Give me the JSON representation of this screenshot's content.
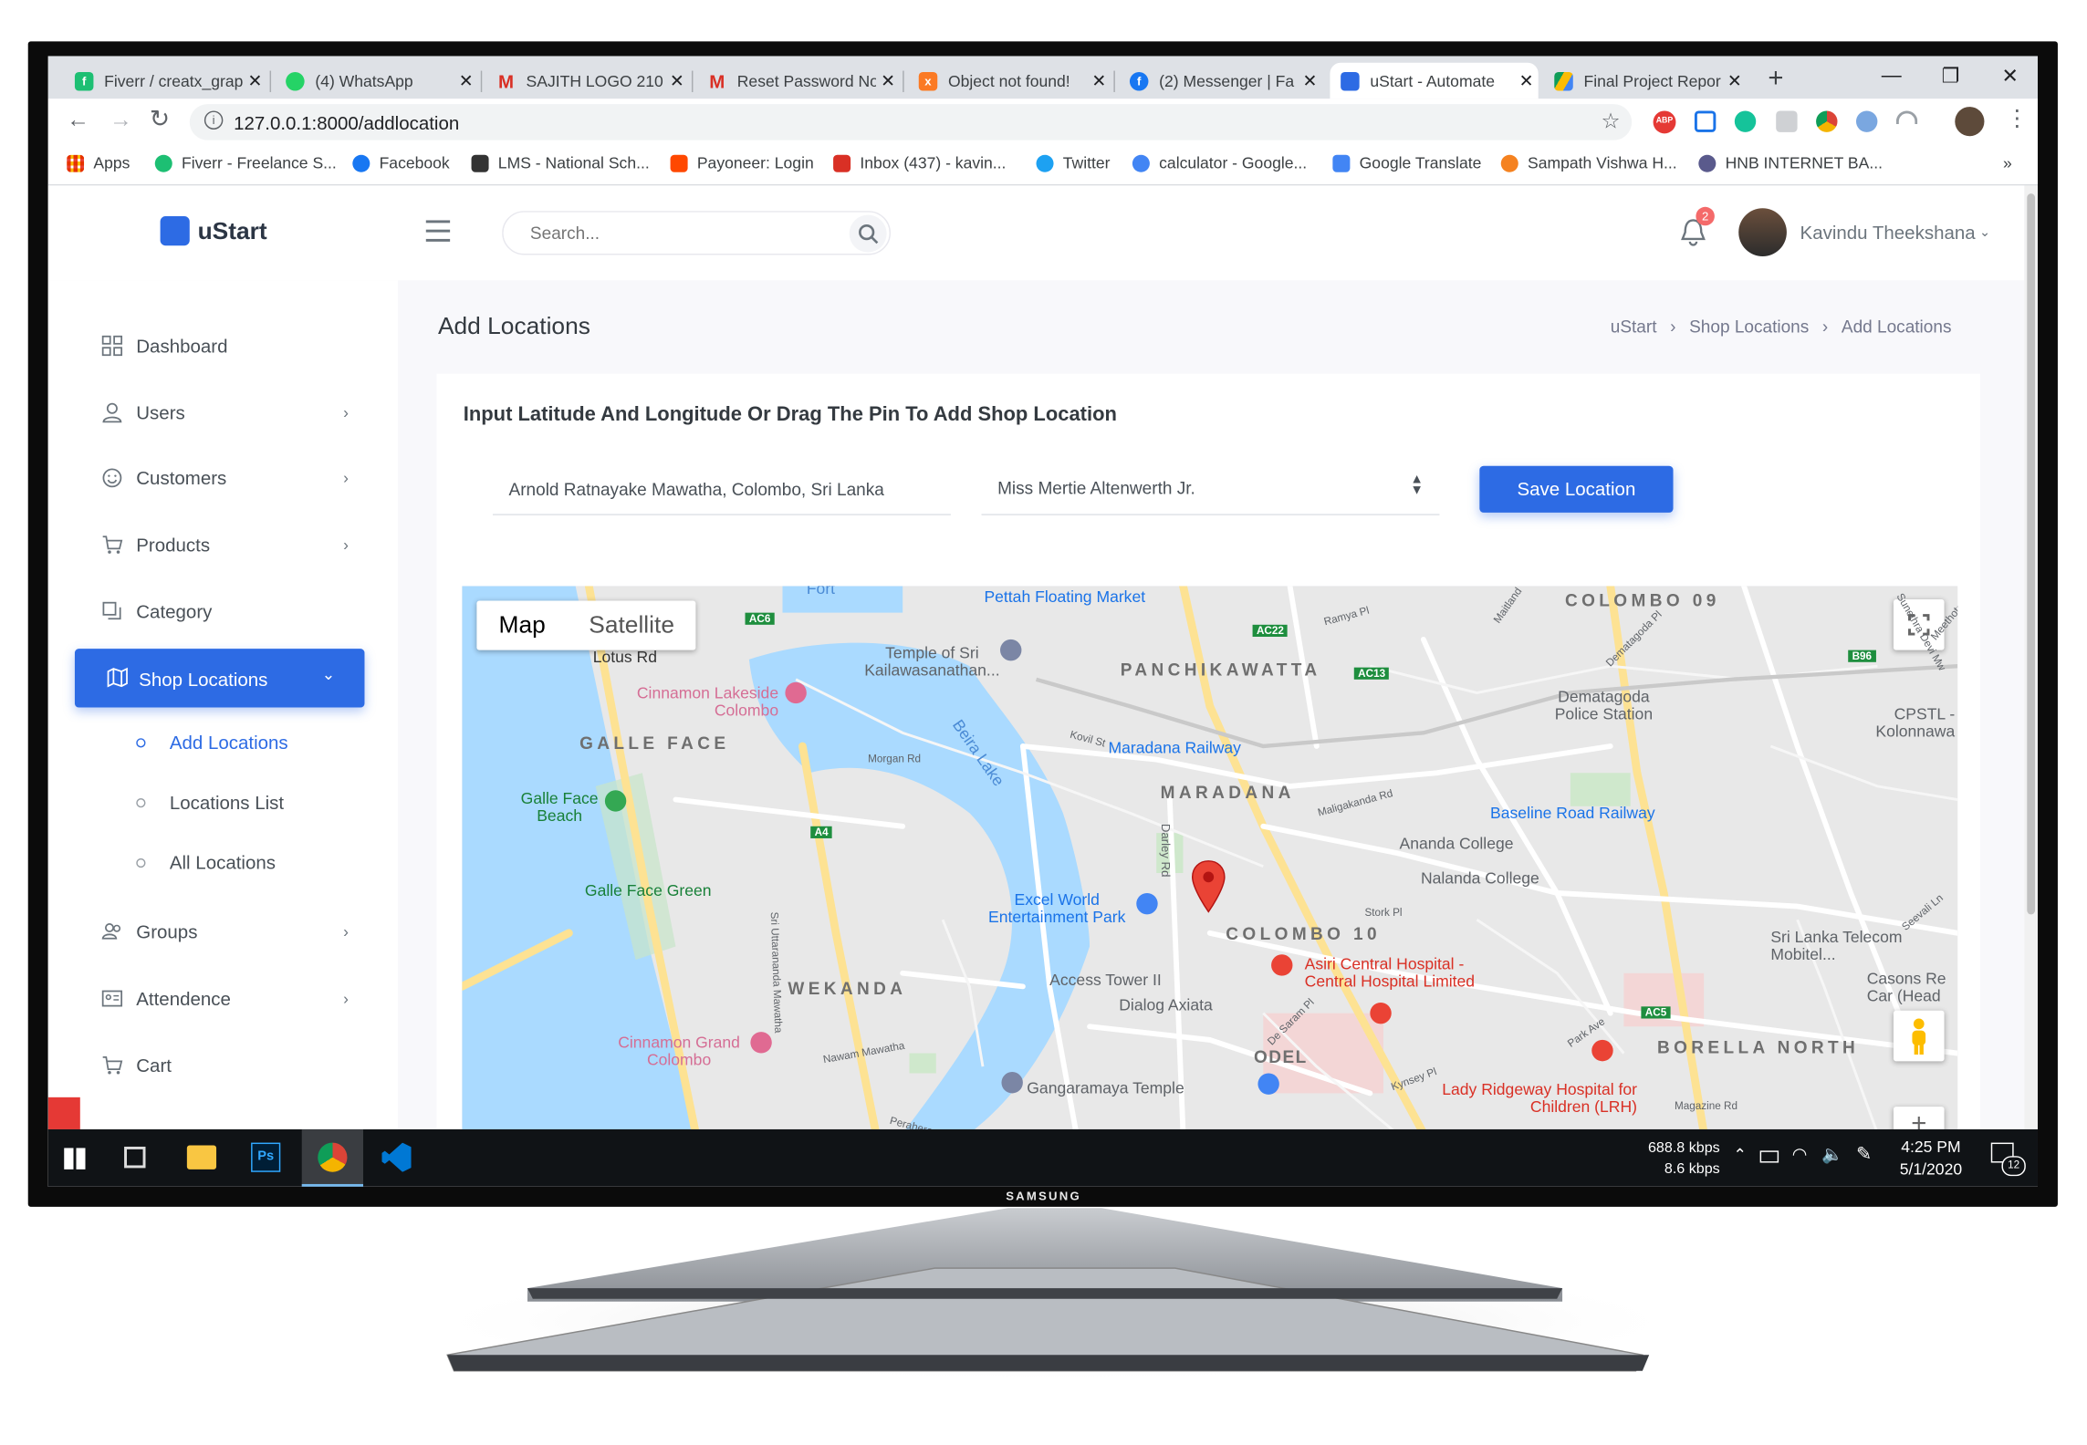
{
  "browser": {
    "tabs": [
      {
        "title": "Fiverr / creatx_grap",
        "icon": "fiverr-icon",
        "color": "#1dbf73"
      },
      {
        "title": "(4) WhatsApp",
        "icon": "whatsapp-icon",
        "color": "#25d366"
      },
      {
        "title": "SAJITH LOGO 210",
        "icon": "gmail-icon",
        "color": "#d93025"
      },
      {
        "title": "Reset Password No",
        "icon": "gmail-icon",
        "color": "#d93025"
      },
      {
        "title": "Object not found!",
        "icon": "xampp-icon",
        "color": "#fb7a24"
      },
      {
        "title": "(2) Messenger | Fa",
        "icon": "facebook-icon",
        "color": "#1877f2"
      },
      {
        "title": "uStart - Automate",
        "icon": "ustart-icon",
        "color": "#2d6be4",
        "active": true
      },
      {
        "title": "Final Project Repor",
        "icon": "drive-icon",
        "color": "#fbbc04"
      }
    ],
    "new_tab_label": "+",
    "url": "127.0.0.1:8000/addlocation",
    "window_controls": {
      "minimize": "—",
      "maximize": "❐",
      "close": "✕"
    },
    "bookmarks": [
      {
        "label": "Apps",
        "color": "#ea4335"
      },
      {
        "label": "Fiverr - Freelance S...",
        "color": "#1dbf73"
      },
      {
        "label": "Facebook",
        "color": "#1877f2"
      },
      {
        "label": "LMS - National Sch...",
        "color": "#333333"
      },
      {
        "label": "Payoneer: Login",
        "color": "#ff4800"
      },
      {
        "label": "Inbox (437) - kavin...",
        "color": "#d93025"
      },
      {
        "label": "Twitter",
        "color": "#1da1f2"
      },
      {
        "label": "calculator - Google...",
        "color": "#4285f4"
      },
      {
        "label": "Google Translate",
        "color": "#4285f4"
      },
      {
        "label": "Sampath Vishwa H...",
        "color": "#f58220"
      },
      {
        "label": "HNB INTERNET BA...",
        "color": "#5a5a8c"
      }
    ],
    "bookmarks_more": "»"
  },
  "app": {
    "logo_text": "uStart",
    "search_placeholder": "Search...",
    "notification_count": "2",
    "user_name": "Kavindu Theekshana",
    "sidebar": {
      "items": [
        {
          "label": "Dashboard",
          "icon": "grid-icon"
        },
        {
          "label": "Users",
          "icon": "user-icon"
        },
        {
          "label": "Customers",
          "icon": "smile-icon"
        },
        {
          "label": "Products",
          "icon": "cart-icon"
        },
        {
          "label": "Category",
          "icon": "copy-icon"
        },
        {
          "label": "Shop Locations",
          "icon": "map-icon"
        },
        {
          "label": "Groups",
          "icon": "users-icon"
        },
        {
          "label": "Attendence",
          "icon": "id-card-icon"
        },
        {
          "label": "Cart",
          "icon": "cart-icon"
        }
      ],
      "sub_items": [
        "Add Locations",
        "Locations List",
        "All Locations"
      ]
    },
    "page_title": "Add Locations",
    "breadcrumb": [
      "uStart",
      "Shop Locations",
      "Add Locations"
    ],
    "breadcrumb_sep": "›",
    "card": {
      "heading": "Input Latitude And Longitude Or Drag The Pin To Add Shop Location",
      "address_value": "Arnold Ratnayake Mawatha, Colombo, Sri Lanka",
      "shop_select_value": "Miss Mertie Altenwerth Jr.",
      "save_label": "Save Location"
    },
    "map": {
      "type_buttons": [
        "Map",
        "Satellite"
      ],
      "districts": [
        "COLOMBO 09",
        "PANCHIKAWATTA",
        "GALLE FACE",
        "MARADANA",
        "COLOMBO 10",
        "WEKANDA",
        "BORELLA NORTH",
        "ODEL"
      ],
      "places": [
        "Pettah Floating Market",
        "Temple of Sri Kailawasanathan...",
        "Cinnamon Lakeside Colombo",
        "Dematagoda Police Station",
        "CPSTL - Kolonnawa Terminal",
        "Maradana Railway",
        "Galle Face Beach",
        "Baseline Road Railway",
        "Ananda College",
        "Nalanda College",
        "Galle Face Green",
        "Excel World Entertainment Park",
        "Sri Lanka Telecom Mobitel...",
        "Asiri Central Hospital - Central Hospital Limited",
        "Access Tower II",
        "Dialog Axiata",
        "Casons Re Car (Head Of",
        "Cinnamon Grand Colombo",
        "Gangaramaya Temple",
        "Lady Ridgeway Hospital for Children (LRH)",
        "Lotus Rd",
        "Beira Lake"
      ],
      "road_labels": [
        "Darley Rd",
        "Morgan Rd",
        "Kovil St",
        "Maligakanda Rd",
        "Sri Uttarananda Mawatha",
        "Nawam Mawatha",
        "De Saram Pl",
        "Kynsey Pl",
        "Park Ave",
        "Stork Pl",
        "Magazine Rd",
        "Perahera",
        "Fort",
        "Ramya Pl",
        "Maitland",
        "Seevali Ln",
        "Sunethra Devi Mw",
        "Dematagoda Pl",
        "Meethotamulla Rd"
      ],
      "road_codes": [
        "AC6",
        "AC22",
        "AC13",
        "A4",
        "B96",
        "AC5"
      ]
    }
  },
  "taskbar": {
    "net_down": "688.8 kbps",
    "net_up": "8.6 kbps",
    "time": "4:25 PM",
    "date": "5/1/2020",
    "notification_count": "12"
  },
  "monitor_brand": "SAMSUNG"
}
